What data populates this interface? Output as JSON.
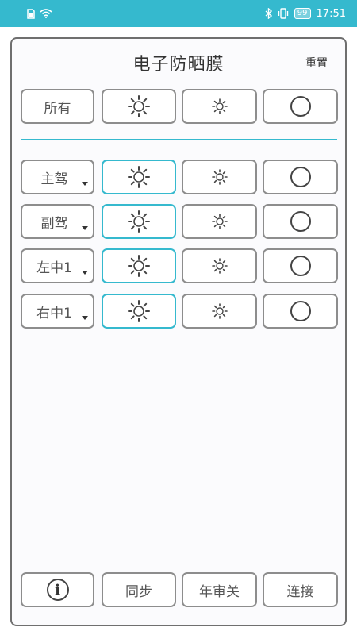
{
  "status_bar": {
    "time": "17:51",
    "battery": "99"
  },
  "title": "电子防晒膜",
  "reset_label": "重置",
  "rows": {
    "all": {
      "label": "所有"
    },
    "items": [
      {
        "label": "主驾"
      },
      {
        "label": "副驾"
      },
      {
        "label": "左中1"
      },
      {
        "label": "右中1"
      }
    ]
  },
  "bottom": {
    "sync_label": "同步",
    "inspection_label": "年审关",
    "connect_label": "连接"
  },
  "colors": {
    "accent": "#35b9ce",
    "border": "#8d8d8d"
  }
}
